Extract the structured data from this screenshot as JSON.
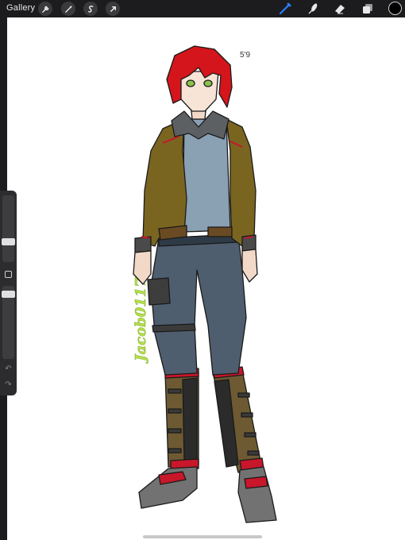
{
  "topbar": {
    "gallery_label": "Gallery",
    "left_tools": [
      "wrench-icon",
      "magic-wand-icon",
      "selection-icon",
      "transform-arrow-icon"
    ],
    "right_tools": [
      "brush-icon",
      "smudge-icon",
      "eraser-icon",
      "layers-icon"
    ],
    "active_tool": "brush-icon",
    "active_color": "#000000",
    "accent": "#2a7fff"
  },
  "sidebar": {
    "brush_size_icon": "slider",
    "modify_icon": "square-icon",
    "opacity_icon": "slider",
    "undo_icon": "undo-icon",
    "redo_icon": "redo-icon"
  },
  "canvas": {
    "height_note": "5'9",
    "signature": "Jacob0117"
  }
}
